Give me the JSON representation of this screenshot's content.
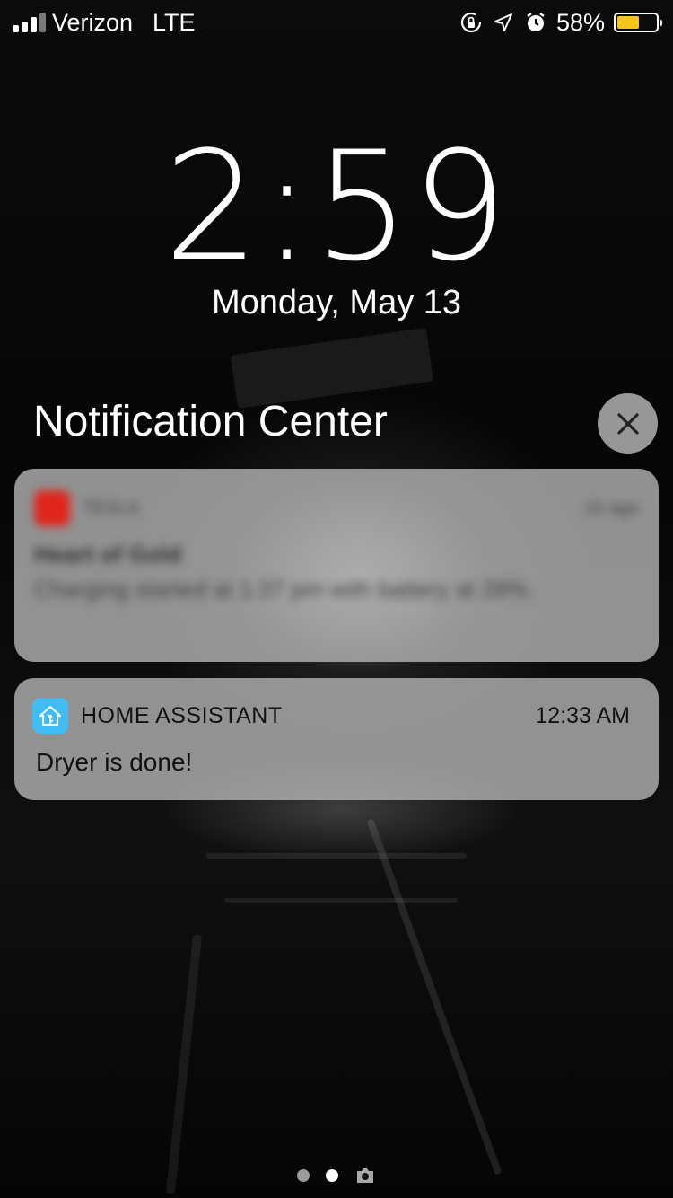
{
  "status_bar": {
    "carrier": "Verizon",
    "network": "LTE",
    "icons": [
      "orientation-lock-icon",
      "location-icon",
      "alarm-icon"
    ],
    "battery_percent": "58%",
    "battery_level": 0.58,
    "battery_color": "#f5c518"
  },
  "lock_screen": {
    "time": "2:59",
    "date": "Monday, May 13"
  },
  "notification_center": {
    "title": "Notification Center",
    "close_icon": "close-icon",
    "notifications": [
      {
        "app": "TESLA",
        "time": "1h ago",
        "title": "Heart of Gold",
        "body": "Charging started at 1:37 pm with battery at 28%.",
        "icon": "tesla-icon",
        "icon_color": "#e0251b",
        "blurred": true
      },
      {
        "app": "HOME ASSISTANT",
        "time": "12:33 AM",
        "body": "Dryer is done!",
        "icon": "home-assistant-icon",
        "icon_color": "#41bdf5",
        "blurred": false
      }
    ]
  },
  "pager": {
    "pages": 2,
    "active_page": 2,
    "extra": "camera-icon"
  }
}
